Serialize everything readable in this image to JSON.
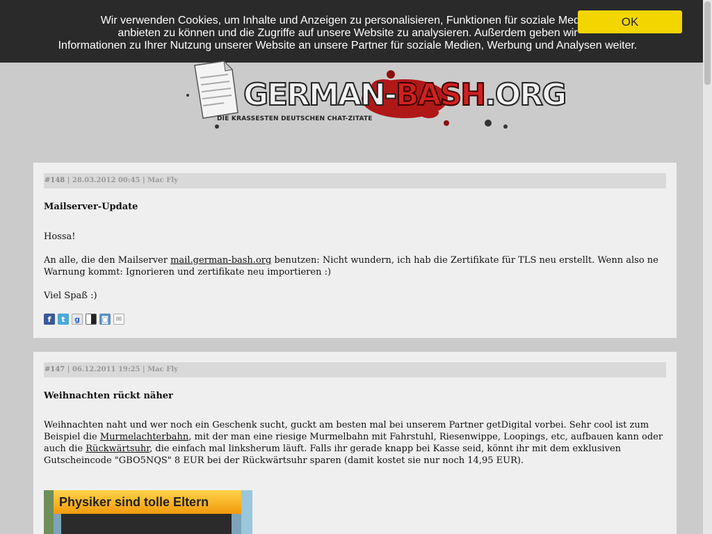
{
  "cookie": {
    "text": "Wir verwenden Cookies, um Inhalte und Anzeigen zu personalisieren, Funktionen für soziale Medien\nanbieten zu können und die Zugriffe auf unsere Website zu analysieren. Außerdem geben wir\nInformationen zu Ihrer Nutzung unserer Website an unsere Partner für soziale Medien, Werbung und Analysen weiter.",
    "ok_label": "OK"
  },
  "logo": {
    "name_left": "GERMAN-",
    "name_mid": "BASH",
    "name_right": ".ORG",
    "tagline": "DIE KRASSESTEN DEUTSCHEN CHAT-ZITATE"
  },
  "posts": [
    {
      "number": "#148",
      "meta": "| 28.03.2012 00:45 | Mac Fly",
      "title": "Mailserver-Update",
      "greeting": "Hossa!",
      "body_before_link": "An alle, die den Mailserver ",
      "link": "mail.german-bash.org",
      "body_after_link": " benutzen: Nicht wundern, ich hab die Zertifikate für TLS neu erstellt. Wenn also ne Warnung kommt: Ignorieren und zertifikate neu importieren :)",
      "closing": "Viel Spaß :)",
      "share_icons": [
        "facebook-icon",
        "twitter-icon",
        "google-icon",
        "delicious-icon",
        "studivz-icon",
        "email-icon"
      ]
    },
    {
      "number": "#147",
      "meta": "| 06.12.2011 19:25 | Mac Fly",
      "title": "Weihnachten rückt näher",
      "body_1": "Weihnachten naht und wer noch ein Geschenk sucht, guckt am besten mal bei unserem Partner getDigital vorbei. Sehr cool ist zum Beispiel die ",
      "link_1": "Murmelachterbahn",
      "body_2": ", mit der man eine riesige Murmelbahn mit Fahrstuhl, Riesenwippe, Loopings, etc, aufbauen kann oder auch die ",
      "link_2": "Rückwärtsuhr",
      "body_3": ", die einfach mal linksherum läuft. Falls ihr gerade knapp bei Kasse seid, könnt ihr mit dem exklusiven Gutscheincode \"GBO5NQS\" 8 EUR bei der Rückwärtsuhr sparen (damit kostet sie nur noch 14,95 EUR).",
      "promo_title": "Physiker sind tolle Eltern"
    }
  ],
  "colors": {
    "page_bg": "#cbcbcb",
    "cookie_bg": "#2a2a2a",
    "ok_button": "#f3d600",
    "post_bg": "#efefef",
    "meta_bg": "#d9d9d9",
    "logo_red": "#b01818"
  }
}
